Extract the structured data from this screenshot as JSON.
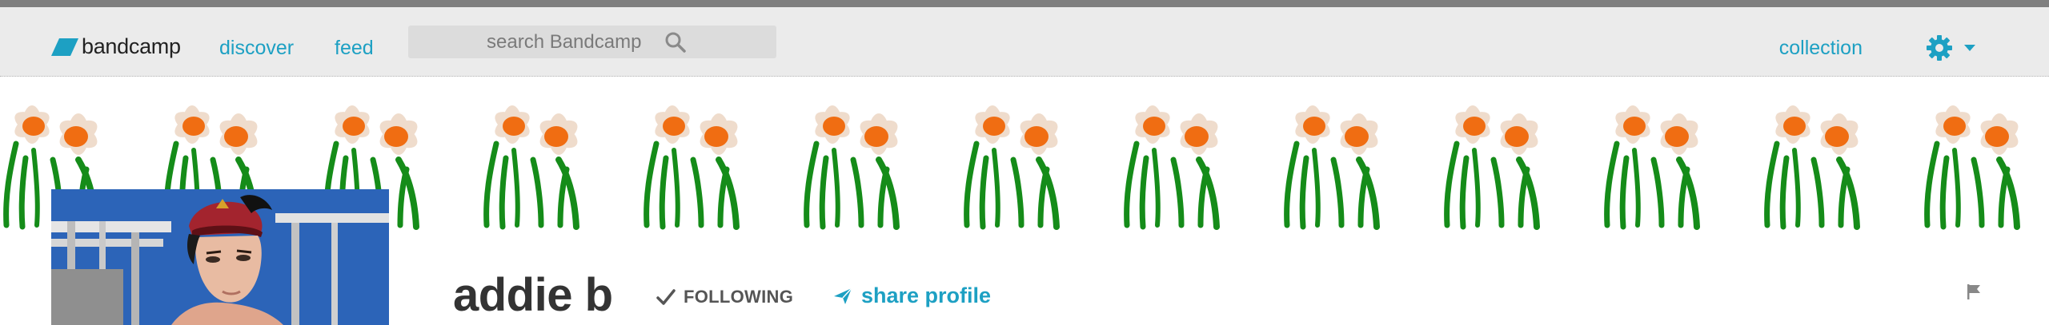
{
  "brand": {
    "name": "bandcamp",
    "accent": "#1da0c3",
    "logo_color": "#1da0c3"
  },
  "nav": {
    "discover": "discover",
    "feed": "feed"
  },
  "search": {
    "placeholder": "search Bandcamp",
    "value": ""
  },
  "user_menu": {
    "collection": "collection",
    "settings_icon": "gear-icon",
    "dropdown_icon": "chevron-down-icon"
  },
  "banner": {
    "motif": "daffodils",
    "petal_color": "#efdccc",
    "cup_color": "#f06d12",
    "stem_color": "#158c19"
  },
  "profile": {
    "name": "addie b",
    "follow_status": "FOLLOWING",
    "share_label": "share profile",
    "report_icon": "flag-icon"
  }
}
